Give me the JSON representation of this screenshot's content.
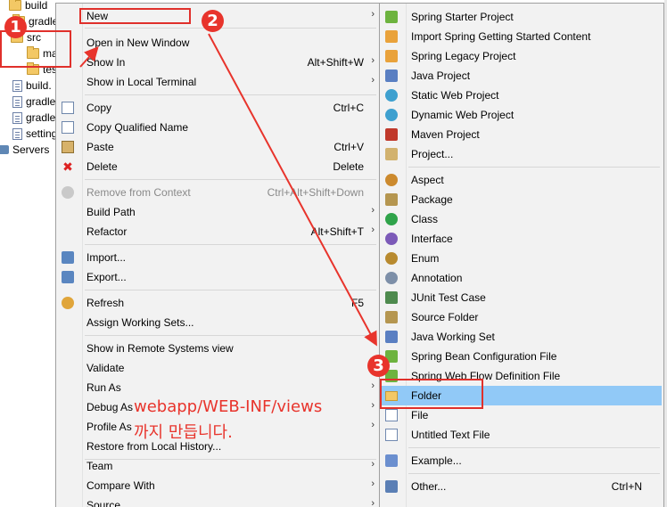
{
  "tree": {
    "items": [
      {
        "label": "build",
        "icon": "folder-icon"
      },
      {
        "label": "gradle",
        "icon": "folder-icon"
      },
      {
        "label": "src",
        "icon": "folder-icon"
      },
      {
        "label": "ma",
        "icon": "folder-icon"
      },
      {
        "label": "tes",
        "icon": "folder-icon"
      },
      {
        "label": "build.",
        "icon": "file-icon"
      },
      {
        "label": "gradle",
        "icon": "file-icon"
      },
      {
        "label": "gradle",
        "icon": "file-icon"
      },
      {
        "label": "setting",
        "icon": "file-icon"
      },
      {
        "label": "Servers",
        "icon": "server-icon"
      }
    ]
  },
  "context_menu": {
    "items": [
      {
        "label": "New",
        "accel": "",
        "submenu": true
      },
      {
        "label": "Open in New Window",
        "accel": ""
      },
      {
        "label": "Show In",
        "accel": "Alt+Shift+W",
        "submenu": true
      },
      {
        "label": "Show in Local Terminal",
        "accel": "",
        "submenu": true
      },
      {
        "label": "Copy",
        "accel": "Ctrl+C"
      },
      {
        "label": "Copy Qualified Name",
        "accel": ""
      },
      {
        "label": "Paste",
        "accel": "Ctrl+V"
      },
      {
        "label": "Delete",
        "accel": "Delete"
      },
      {
        "label": "Remove from Context",
        "accel": "Ctrl+Alt+Shift+Down"
      },
      {
        "label": "Build Path",
        "accel": "",
        "submenu": true
      },
      {
        "label": "Refactor",
        "accel": "Alt+Shift+T",
        "submenu": true
      },
      {
        "label": "Import...",
        "accel": ""
      },
      {
        "label": "Export...",
        "accel": ""
      },
      {
        "label": "Refresh",
        "accel": "F5"
      },
      {
        "label": "Assign Working Sets...",
        "accel": ""
      },
      {
        "label": "Show in Remote Systems view",
        "accel": ""
      },
      {
        "label": "Validate",
        "accel": ""
      },
      {
        "label": "Run As",
        "accel": "",
        "submenu": true
      },
      {
        "label": "Debug As",
        "accel": "",
        "submenu": true
      },
      {
        "label": "Profile As",
        "accel": "",
        "submenu": true
      },
      {
        "label": "Restore from Local History...",
        "accel": ""
      },
      {
        "label": "Team",
        "accel": "",
        "submenu": true
      },
      {
        "label": "Compare With",
        "accel": "",
        "submenu": true
      },
      {
        "label": "Source",
        "accel": "",
        "submenu": true
      }
    ]
  },
  "submenu": {
    "items": [
      {
        "label": "Spring Starter Project",
        "accel": ""
      },
      {
        "label": "Import Spring Getting Started Content",
        "accel": ""
      },
      {
        "label": "Spring Legacy Project",
        "accel": ""
      },
      {
        "label": "Java Project",
        "accel": ""
      },
      {
        "label": "Static Web Project",
        "accel": ""
      },
      {
        "label": "Dynamic Web Project",
        "accel": ""
      },
      {
        "label": "Maven Project",
        "accel": ""
      },
      {
        "label": "Project...",
        "accel": ""
      },
      {
        "label": "Aspect",
        "accel": ""
      },
      {
        "label": "Package",
        "accel": ""
      },
      {
        "label": "Class",
        "accel": ""
      },
      {
        "label": "Interface",
        "accel": ""
      },
      {
        "label": "Enum",
        "accel": ""
      },
      {
        "label": "Annotation",
        "accel": ""
      },
      {
        "label": "JUnit Test Case",
        "accel": ""
      },
      {
        "label": "Source Folder",
        "accel": ""
      },
      {
        "label": "Java Working Set",
        "accel": ""
      },
      {
        "label": "Spring Bean Configuration File",
        "accel": ""
      },
      {
        "label": "Spring Web Flow Definition File",
        "accel": ""
      },
      {
        "label": "Folder",
        "accel": ""
      },
      {
        "label": "File",
        "accel": ""
      },
      {
        "label": "Untitled Text File",
        "accel": ""
      },
      {
        "label": "Example...",
        "accel": ""
      },
      {
        "label": "Other...",
        "accel": "Ctrl+N"
      }
    ]
  },
  "annotations": {
    "badges": [
      "1",
      "2",
      "3"
    ],
    "note_line1": "webapp/WEB-INF/views",
    "note_line2": "까지 만듭니다."
  },
  "colors": {
    "highlight": "#91c9f7",
    "annotation_red": "#e8342c"
  }
}
